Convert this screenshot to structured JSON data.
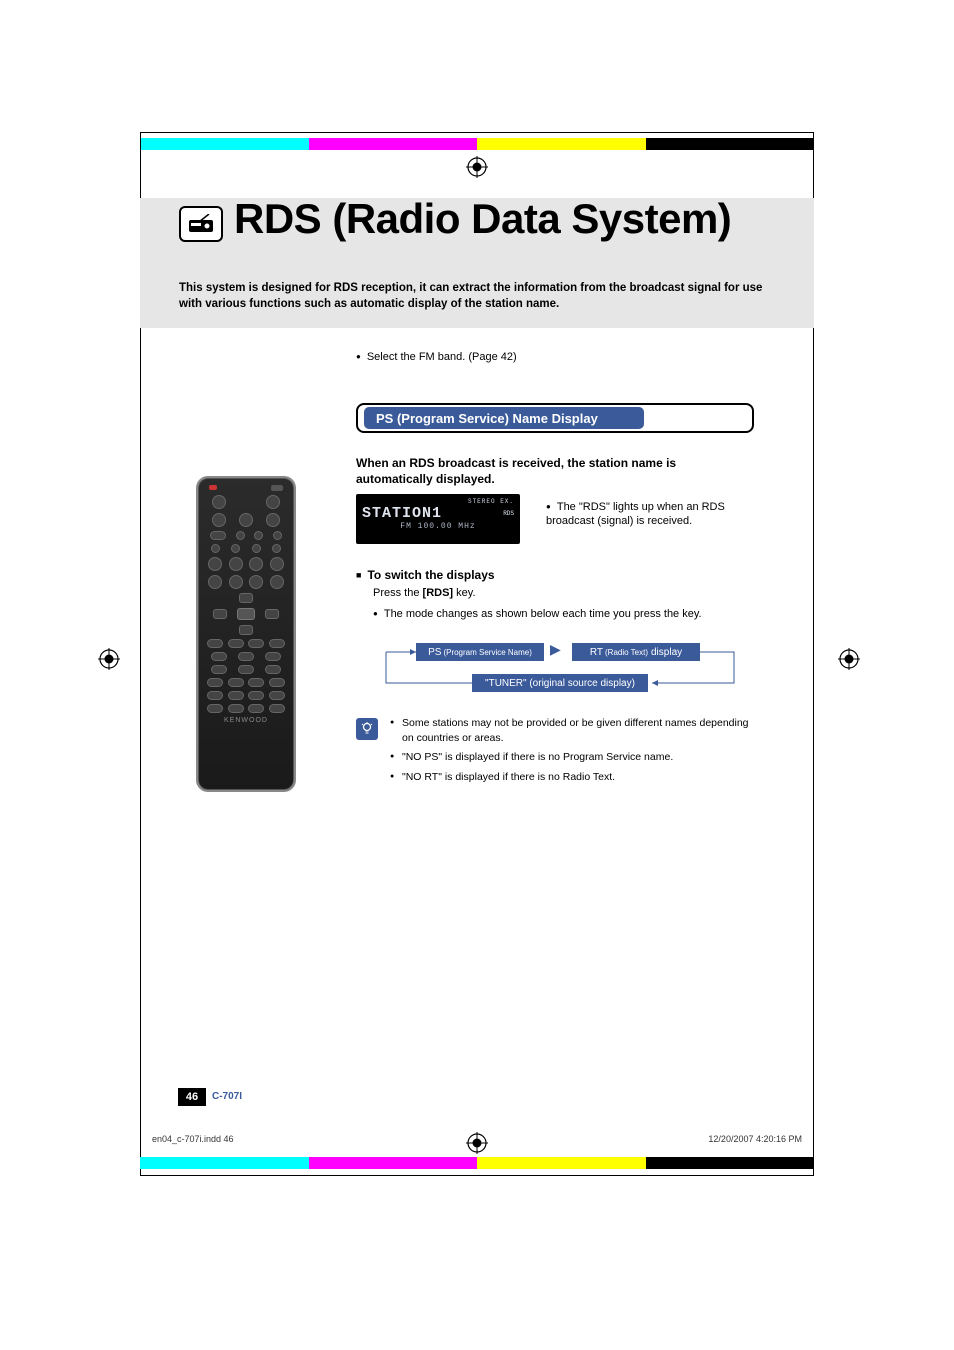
{
  "title": "RDS (Radio Data System)",
  "intro": "This system is designed for RDS reception, it can extract the information from the broadcast signal for use with various functions such as automatic display of the station name.",
  "select_fm": "Select the FM band. (Page 42)",
  "section_title": "PS (Program Service) Name Display",
  "sub_intro": "When an RDS broadcast is received, the station name is automatically displayed.",
  "lcd": {
    "top": "STEREO  EX.",
    "main": "STATION1",
    "sub": "FM   100.00 MHz",
    "rds": "RDS"
  },
  "lcd_note": "The \"RDS\" lights up when an RDS broadcast (signal) is received.",
  "switch_heading": "To switch the displays",
  "press": "Press the [RDS] key.",
  "mode_line": "The mode changes as shown below each time you press the key.",
  "flow": {
    "ps_label": "PS",
    "ps_sub": "(Program Service Name)",
    "rt_label": "RT",
    "rt_sub": "(Radio Text)",
    "rt_tail": "display",
    "tuner": "\"TUNER\" (original source display)"
  },
  "tips": [
    "Some stations may not be provided or be given different names depending on countries or areas.",
    "\"NO PS\" is displayed if there is no Program Service name.",
    "\"NO RT\" is displayed if there is no Radio Text."
  ],
  "remote_brand": "KENWOOD",
  "page_number": "46",
  "model": "C-707I",
  "footer_left": "en04_c-707i.indd   46",
  "footer_right": "12/20/2007   4:20:16 PM"
}
